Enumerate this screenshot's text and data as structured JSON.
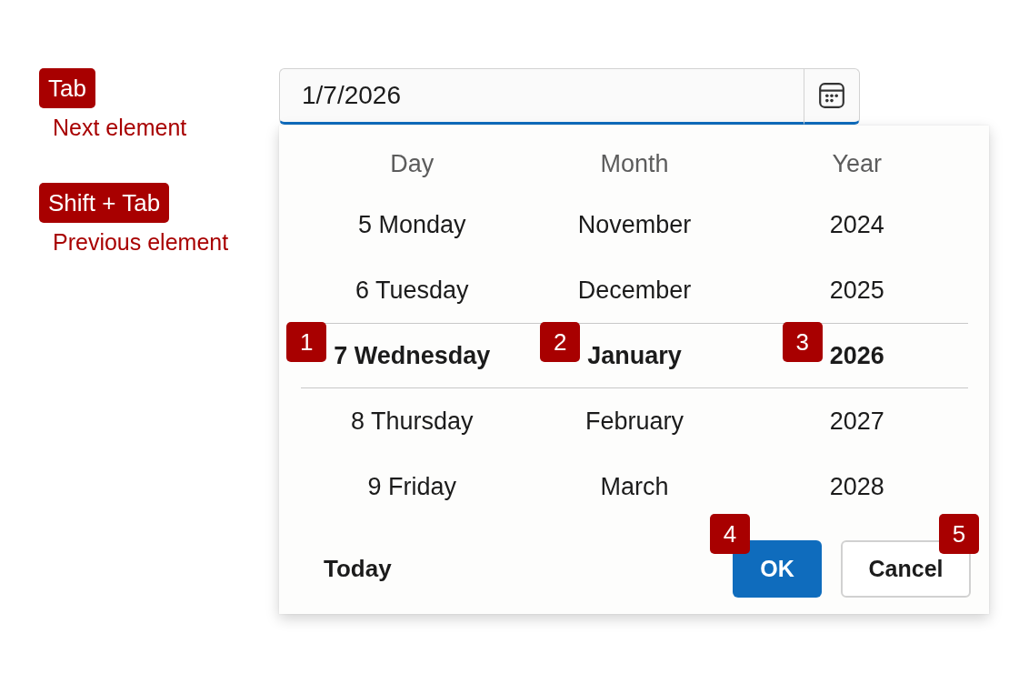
{
  "shortcuts": [
    {
      "key": "Tab",
      "description": "Next element"
    },
    {
      "key": "Shift + Tab",
      "description": "Previous element"
    }
  ],
  "date_field": {
    "value": "1/7/2026"
  },
  "picker": {
    "columns": [
      {
        "header": "Day",
        "items": [
          {
            "label": "5 Monday",
            "selected": false
          },
          {
            "label": "6 Tuesday",
            "selected": false
          },
          {
            "label": "7 Wednesday",
            "selected": true,
            "callout": "1"
          },
          {
            "label": "8 Thursday",
            "selected": false
          },
          {
            "label": "9 Friday",
            "selected": false
          }
        ]
      },
      {
        "header": "Month",
        "items": [
          {
            "label": "November",
            "selected": false
          },
          {
            "label": "December",
            "selected": false
          },
          {
            "label": "January",
            "selected": true,
            "callout": "2"
          },
          {
            "label": "February",
            "selected": false
          },
          {
            "label": "March",
            "selected": false
          }
        ]
      },
      {
        "header": "Year",
        "items": [
          {
            "label": "2024",
            "selected": false
          },
          {
            "label": "2025",
            "selected": false
          },
          {
            "label": "2026",
            "selected": true,
            "callout": "3"
          },
          {
            "label": "2027",
            "selected": false
          },
          {
            "label": "2028",
            "selected": false
          }
        ]
      }
    ],
    "today_button": "Today",
    "buttons": [
      {
        "label": "OK",
        "kind": "primary",
        "callout": "4"
      },
      {
        "label": "Cancel",
        "kind": "secondary",
        "callout": "5"
      }
    ]
  }
}
